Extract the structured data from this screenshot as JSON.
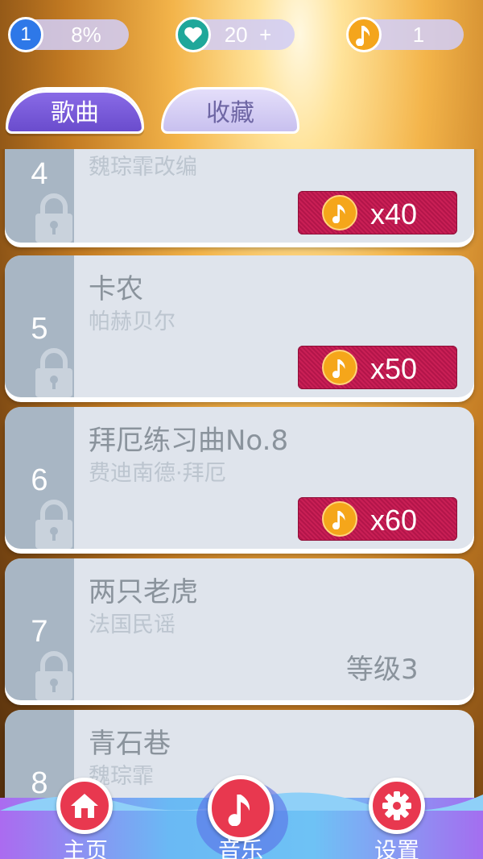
{
  "header": {
    "level": {
      "badge": "1",
      "value": "8%",
      "icon": "level-badge"
    },
    "lives": {
      "value": "20",
      "add_label": "+",
      "icon": "heart-icon"
    },
    "coins": {
      "value": "1",
      "icon": "music-note-coin-icon"
    }
  },
  "tabs": [
    {
      "label": "歌曲",
      "active": true
    },
    {
      "label": "收藏",
      "active": false
    }
  ],
  "songs": [
    {
      "number": "4",
      "title": "",
      "artist": "魏琮霏改编",
      "locked": true,
      "cost": "x40"
    },
    {
      "number": "5",
      "title": "卡农",
      "artist": "帕赫贝尔",
      "locked": true,
      "cost": "x50"
    },
    {
      "number": "6",
      "title": "拜厄练习曲No.8",
      "artist": "费迪南德·拜厄",
      "locked": true,
      "cost": "x60"
    },
    {
      "number": "7",
      "title": "两只老虎",
      "artist": "法国民谣",
      "locked": true,
      "requirement": "等级3"
    },
    {
      "number": "8",
      "title": "青石巷",
      "artist": "魏琮霏",
      "locked": true
    }
  ],
  "nav": {
    "home": {
      "label": "主页",
      "icon": "house-icon"
    },
    "music": {
      "label": "音乐",
      "icon": "music-note-icon"
    },
    "settings": {
      "label": "设置",
      "icon": "gear-icon"
    }
  },
  "colors": {
    "accent_purple": "#6a4ccd",
    "price_red": "#c91f55",
    "coin_gold": "#f5a61a",
    "card_bg": "#dfe4ec",
    "card_side": "#a8b6c4"
  }
}
